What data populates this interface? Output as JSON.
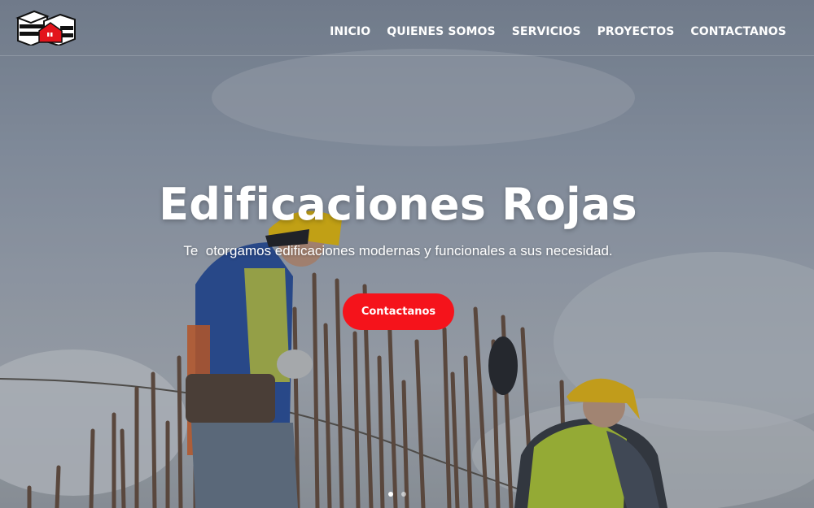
{
  "brand": {
    "logo_icon": "building-logo-icon",
    "accent_color": "#f5131b"
  },
  "nav": {
    "items": [
      {
        "label": "INICIO"
      },
      {
        "label": "QUIENES SOMOS"
      },
      {
        "label": "SERVICIOS"
      },
      {
        "label": "PROYECTOS"
      },
      {
        "label": "CONTACTANOS"
      }
    ]
  },
  "hero": {
    "title": "Edificaciones Rojas",
    "subtitle": "Te  otorgamos edificaciones modernas y funcionales a sus necesidad.",
    "cta_label": "Contactanos",
    "background": "construction-workers-photo",
    "slides": {
      "count": 2,
      "active": 1
    }
  }
}
